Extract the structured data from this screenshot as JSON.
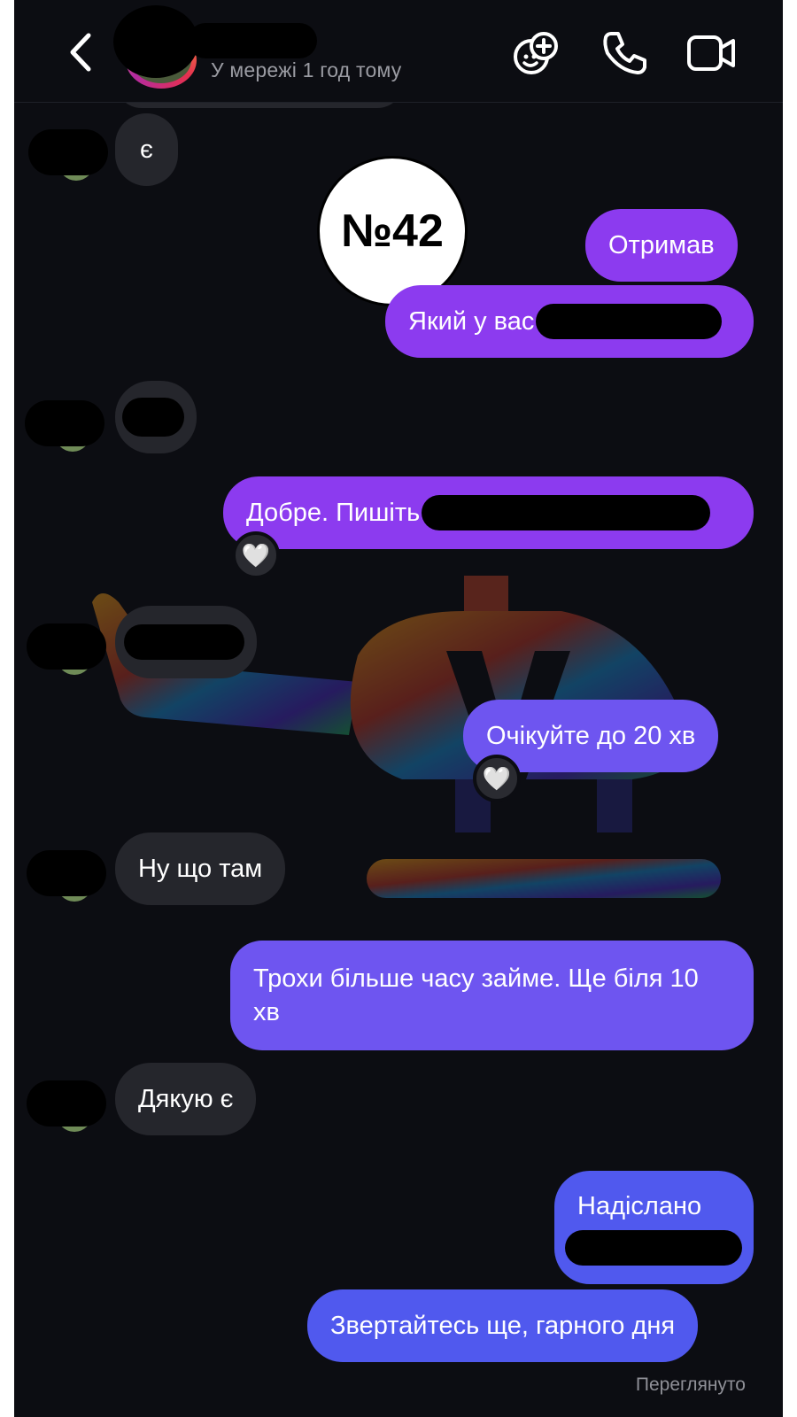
{
  "header": {
    "status": "У мережі 1 год тому",
    "icons": [
      "back-icon",
      "effects-icon",
      "phone-icon",
      "video-icon"
    ]
  },
  "messages": [
    {
      "direction": "in",
      "text": "є"
    },
    {
      "direction": "out",
      "text": "Отримав"
    },
    {
      "direction": "out",
      "text": "Який у вас",
      "redacted_suffix": true
    },
    {
      "direction": "in",
      "text": "",
      "redacted": true
    },
    {
      "direction": "out",
      "text": "Добре. Пишіть",
      "redacted_suffix": true,
      "reaction": "🤍"
    },
    {
      "direction": "in",
      "text": "",
      "redacted": true
    },
    {
      "direction": "out",
      "text": "Очікуйте до 20 хв",
      "reaction": "🤍"
    },
    {
      "direction": "in",
      "text": "Ну що там"
    },
    {
      "direction": "out",
      "text": "Трохи більше часу займе. Ще біля 10 хв"
    },
    {
      "direction": "in",
      "text": "Дякую є"
    },
    {
      "direction": "out",
      "text": "Надіслано",
      "redacted_suffix": true
    },
    {
      "direction": "out",
      "text": "Звертайтесь ще, гарного дня"
    }
  ],
  "seen_label": "Переглянуто",
  "stamp": "№42",
  "colors": {
    "background": "#0c0d12",
    "incoming": "#25262c",
    "outgoing_top": "#8c3bef",
    "outgoing_mid": "#6e55f0",
    "outgoing_bottom": "#5059ee"
  }
}
